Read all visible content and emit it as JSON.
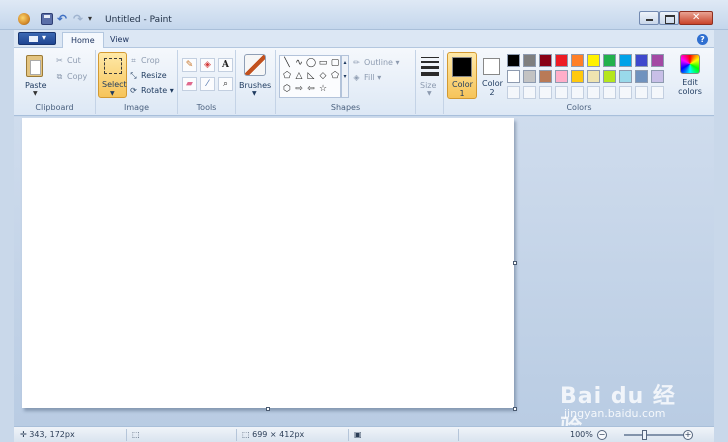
{
  "window": {
    "title": "Untitled - Paint"
  },
  "tabs": {
    "home": "Home",
    "view": "View"
  },
  "ribbon": {
    "clipboard": {
      "group_label": "Clipboard",
      "paste": "Paste",
      "cut": "Cut",
      "copy": "Copy"
    },
    "image": {
      "group_label": "Image",
      "select": "Select",
      "crop": "Crop",
      "resize": "Resize",
      "rotate": "Rotate"
    },
    "tools": {
      "group_label": "Tools",
      "text_tool_glyph": "A"
    },
    "brushes": {
      "label": "Brushes"
    },
    "shapes": {
      "group_label": "Shapes",
      "outline": "Outline",
      "fill": "Fill"
    },
    "size": {
      "label": "Size"
    },
    "colors": {
      "group_label": "Colors",
      "color1_label": "Color 1",
      "color2_label": "Color 2",
      "edit_colors": "Edit colors",
      "color1": "#000000",
      "color2": "#ffffff",
      "palette_row1": [
        "#000000",
        "#7f7f7f",
        "#880015",
        "#ed1c24",
        "#ff7f27",
        "#fff200",
        "#22b14c",
        "#00a2e8",
        "#3f48cc",
        "#a349a4"
      ],
      "palette_row2": [
        "#ffffff",
        "#c3c3c3",
        "#b97a57",
        "#ffaec9",
        "#ffc90e",
        "#efe4b0",
        "#b5e61d",
        "#99d9ea",
        "#7092be",
        "#c8bfe7"
      ]
    }
  },
  "status": {
    "cursor_position": "343, 172px",
    "canvas_size": "699 × 412px",
    "zoom_level": "100%"
  },
  "watermark": {
    "logo": "Bai du 经验",
    "url": "jingyan.baidu.com"
  }
}
